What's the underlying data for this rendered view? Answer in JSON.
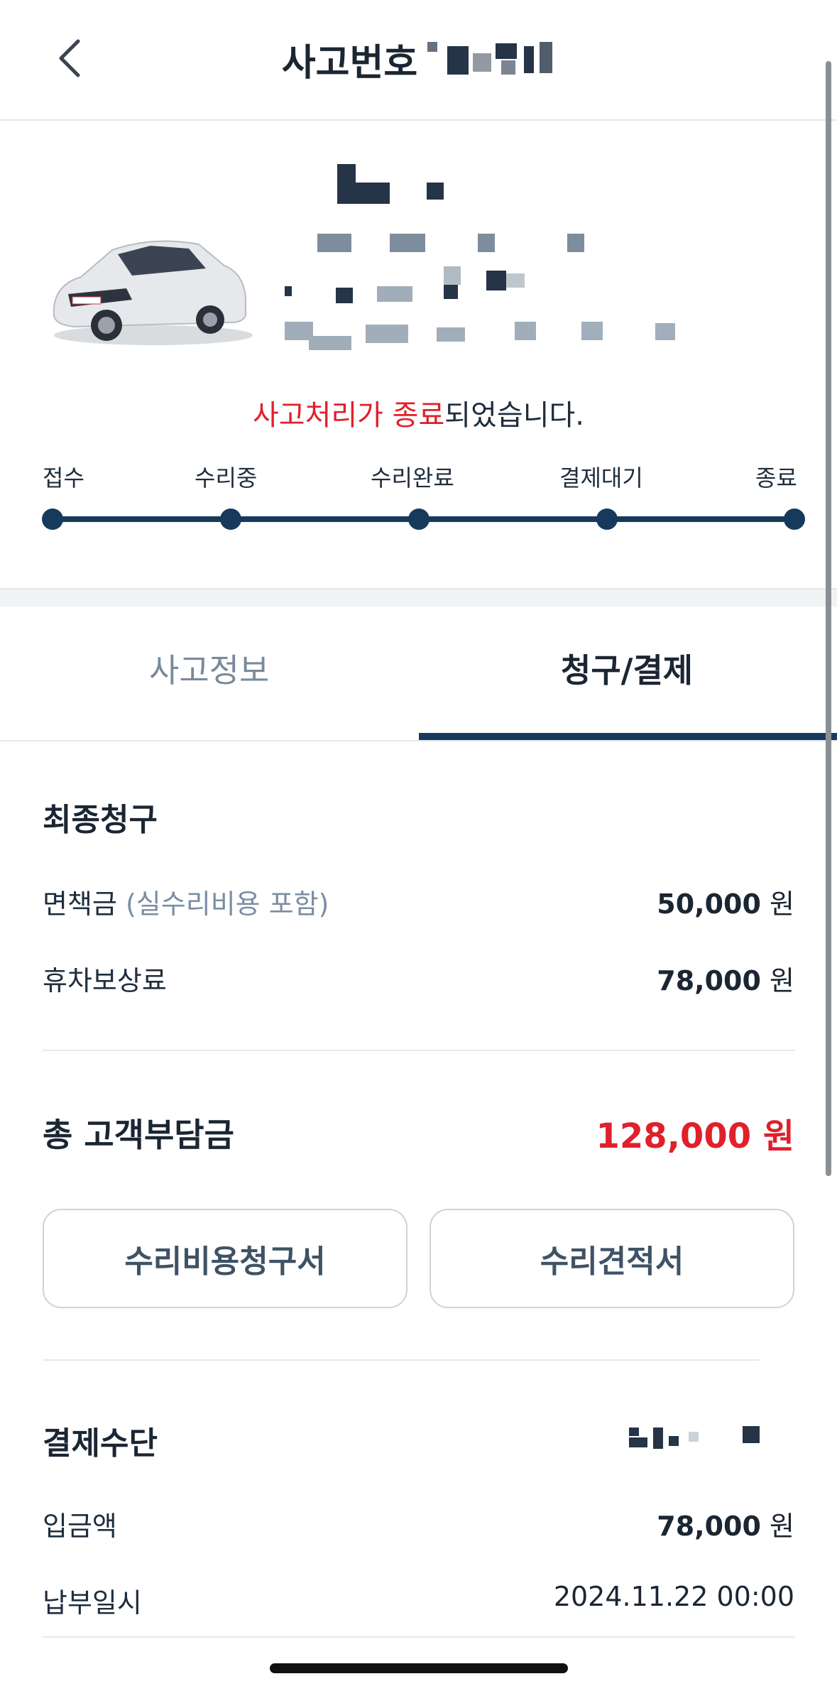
{
  "header": {
    "back_icon": "chevron-left-icon",
    "title": "사고번호"
  },
  "status": {
    "message_highlight": "사고처리가 종료",
    "message_rest": "되었습니다."
  },
  "steps": [
    {
      "label": "접수"
    },
    {
      "label": "수리중"
    },
    {
      "label": "수리완료"
    },
    {
      "label": "결제대기"
    },
    {
      "label": "종료"
    }
  ],
  "tabs": {
    "info": "사고정보",
    "payment": "청구/결제",
    "active": "payment"
  },
  "billing": {
    "title": "최종청구",
    "deductible_label": "면책금",
    "deductible_note": "(실수리비용 포함)",
    "deductible_amount": "50,000",
    "loss_of_use_label": "휴차보상료",
    "loss_of_use_amount": "78,000",
    "unit": "원",
    "total_label": "총 고객부담금",
    "total_amount": "128,000 원"
  },
  "buttons": {
    "repair_invoice": "수리비용청구서",
    "repair_estimate": "수리견적서"
  },
  "payment": {
    "title": "결제수단",
    "deposit_label": "입금액",
    "deposit_amount": "78,000",
    "paid_at_label": "납부일시",
    "paid_at_value": "2024.11.22 00:00"
  },
  "colors": {
    "accent": "#173a5c",
    "alert": "#e0202b",
    "muted": "#7a8a9a"
  }
}
